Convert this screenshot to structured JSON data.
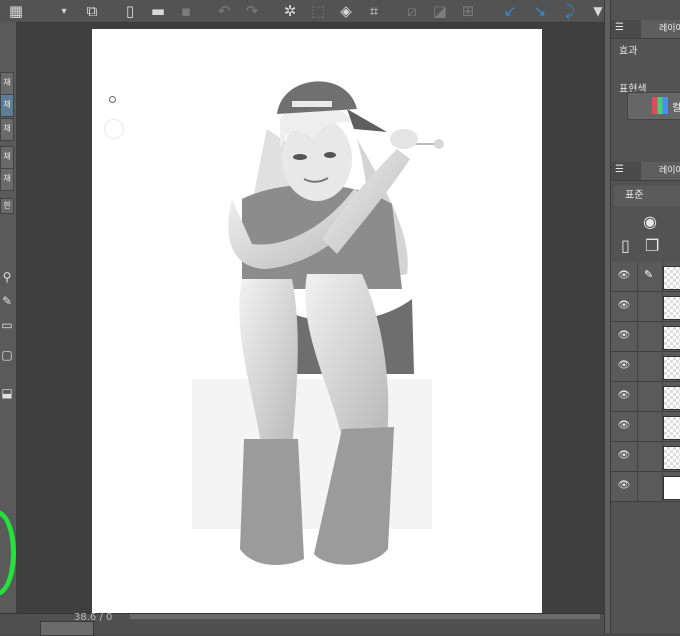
{
  "toolbar": {
    "icons": [
      "grid-menu-icon",
      "dropdown-icon",
      "clipboard-icon",
      "new-file-icon",
      "open-folder-icon",
      "save-icon",
      "undo-icon",
      "redo-icon",
      "loading-icon",
      "transform-icon",
      "fill-icon",
      "crop-icon",
      "ruler-icon",
      "gradient-icon",
      "select-icon",
      "rotate-left-icon",
      "rotate-right-icon",
      "flip-icon",
      "more-icon"
    ]
  },
  "left_panel": {
    "tabs": [
      "채",
      "채",
      "채",
      "채",
      "채",
      "한"
    ]
  },
  "status": {
    "zoom": "38.6 / 0"
  },
  "right_panel": {
    "layer_property_tab": "레이어",
    "effect_label": "효과",
    "expression_color_label": "표현색",
    "color_button_label": "컬",
    "layer_tab": "레이어",
    "blend_mode": "표준"
  },
  "colors": {
    "accent": "#2f8fd8",
    "ring": "#22e23b"
  }
}
